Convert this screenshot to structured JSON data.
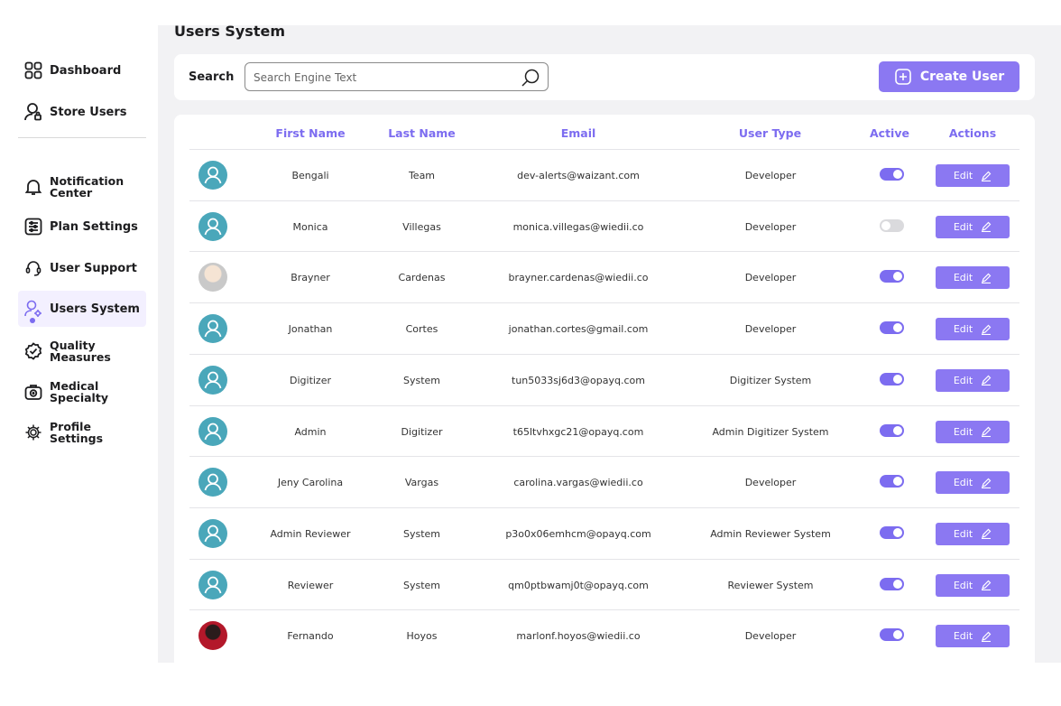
{
  "sidebar": {
    "items": [
      {
        "label": "Dashboard",
        "icon": "dashboard-icon"
      },
      {
        "label": "Store Users",
        "icon": "store-users-icon"
      },
      {
        "label": "Notification Center",
        "icon": "bell-icon"
      },
      {
        "label": "Plan Settings",
        "icon": "plan-settings-icon"
      },
      {
        "label": "User Support",
        "icon": "headset-icon"
      },
      {
        "label": "Users System",
        "icon": "users-system-icon",
        "active": true
      },
      {
        "label": "Quality Measures",
        "icon": "check-badge-icon"
      },
      {
        "label": "Medical Specialty",
        "icon": "medical-bag-icon"
      },
      {
        "label": "Profile Settings",
        "icon": "gear-icon"
      }
    ]
  },
  "page": {
    "title": "Users System"
  },
  "search": {
    "label": "Search",
    "placeholder": "Search Engine Text",
    "value": ""
  },
  "create_user": {
    "label": "Create User"
  },
  "table": {
    "headers": {
      "first_name": "First Name",
      "last_name": "Last Name",
      "email": "Email",
      "user_type": "User Type",
      "active": "Active",
      "actions": "Actions"
    },
    "edit_label": "Edit",
    "rows": [
      {
        "avatar": "default",
        "first_name": "Bengali",
        "last_name": "Team",
        "email": "dev-alerts@waizant.com",
        "user_type": "Developer",
        "active": true
      },
      {
        "avatar": "default",
        "first_name": "Monica",
        "last_name": "Villegas",
        "email": "monica.villegas@wiedii.co",
        "user_type": "Developer",
        "active": false
      },
      {
        "avatar": "photo1",
        "first_name": "Brayner",
        "last_name": "Cardenas",
        "email": "brayner.cardenas@wiedii.co",
        "user_type": "Developer",
        "active": true
      },
      {
        "avatar": "default",
        "first_name": "Jonathan",
        "last_name": "Cortes",
        "email": "jonathan.cortes@gmail.com",
        "user_type": "Developer",
        "active": true
      },
      {
        "avatar": "default",
        "first_name": "Digitizer",
        "last_name": "System",
        "email": "tun5033sj6d3@opayq.com",
        "user_type": "Digitizer System",
        "active": true
      },
      {
        "avatar": "default",
        "first_name": "Admin",
        "last_name": "Digitizer",
        "email": "t65ltvhxgc21@opayq.com",
        "user_type": "Admin Digitizer System",
        "active": true
      },
      {
        "avatar": "default",
        "first_name": "Jeny Carolina",
        "last_name": "Vargas",
        "email": "carolina.vargas@wiedii.co",
        "user_type": "Developer",
        "active": true
      },
      {
        "avatar": "default",
        "first_name": "Admin Reviewer",
        "last_name": "System",
        "email": "p3o0x06emhcm@opayq.com",
        "user_type": "Admin Reviewer System",
        "active": true
      },
      {
        "avatar": "default",
        "first_name": "Reviewer",
        "last_name": "System",
        "email": "qm0ptbwamj0t@opayq.com",
        "user_type": "Reviewer System",
        "active": true
      },
      {
        "avatar": "photo2",
        "first_name": "Fernando",
        "last_name": "Hoyos",
        "email": "marlonf.hoyos@wiedii.co",
        "user_type": "Developer",
        "active": true
      }
    ]
  },
  "colors": {
    "accent": "#7c6cf0",
    "button": "#8b78f2",
    "avatar_default": "#4aa7ba"
  }
}
